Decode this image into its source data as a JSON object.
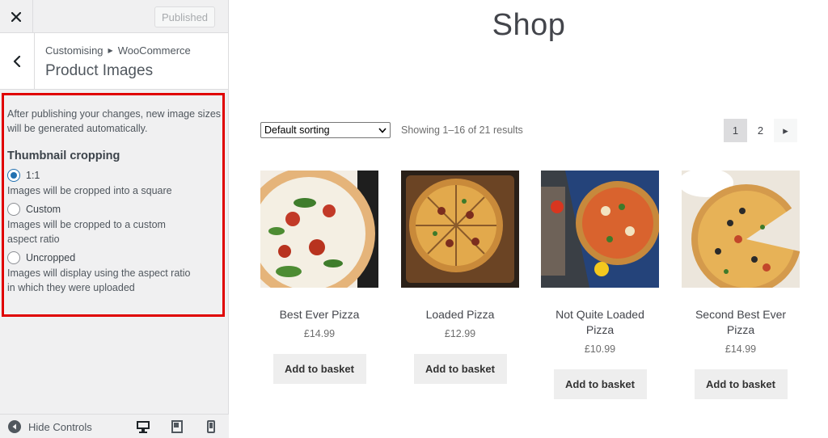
{
  "header": {
    "published_label": "Published"
  },
  "section": {
    "breadcrumb_root": "Customising",
    "breadcrumb_parent": "WooCommerce",
    "title": "Product Images"
  },
  "controls": {
    "description_line1": "After publishing your changes, new image sizes",
    "description_line2": "will be generated automatically.",
    "group_title": "Thumbnail cropping",
    "options": [
      {
        "label": "1:1",
        "desc_line1": "Images will be cropped into a square",
        "desc_line2": "",
        "selected": true
      },
      {
        "label": "Custom",
        "desc_line1": "Images will be cropped to a custom",
        "desc_line2": "aspect ratio",
        "selected": false
      },
      {
        "label": "Uncropped",
        "desc_line1": "Images will display using the aspect ratio",
        "desc_line2": "in which they were uploaded",
        "selected": false
      }
    ]
  },
  "footer": {
    "hide_controls_label": "Hide Controls"
  },
  "shop": {
    "title": "Shop",
    "sort_value": "Default sorting",
    "result_count": "Showing 1–16 of 21 results",
    "pages": [
      "1",
      "2"
    ],
    "next_glyph": "▸",
    "products": [
      {
        "name": "Best Ever Pizza",
        "price": "£14.99",
        "button": "Add to basket"
      },
      {
        "name": "Loaded Pizza",
        "price": "£12.99",
        "button": "Add to basket"
      },
      {
        "name": "Not Quite Loaded Pizza",
        "price": "£10.99",
        "button": "Add to basket"
      },
      {
        "name": "Second Best Ever Pizza",
        "price": "£14.99",
        "button": "Add to basket"
      }
    ]
  },
  "colors": {
    "accent": "#2271b1",
    "highlight_border": "#e00000",
    "button_bg": "#eeeeee"
  },
  "icons": [
    "close-icon",
    "chevron-left-icon",
    "collapse-icon",
    "desktop-icon",
    "tablet-icon",
    "mobile-icon",
    "pizza-image"
  ]
}
